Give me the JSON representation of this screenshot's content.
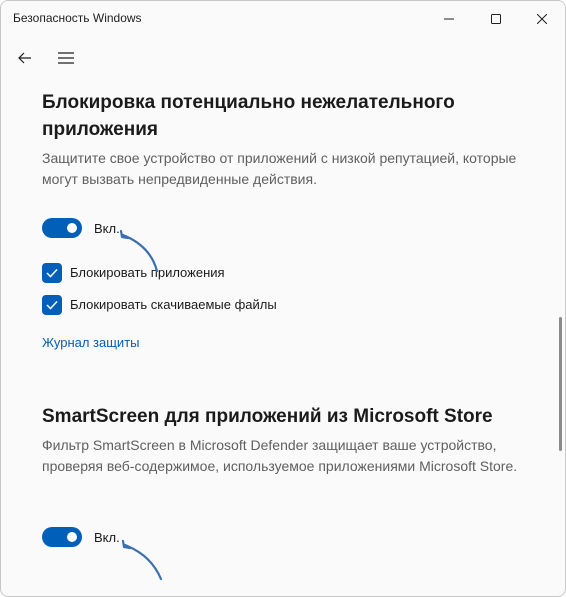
{
  "window": {
    "title": "Безопасность Windows"
  },
  "section1": {
    "heading": "Блокировка потенциально нежелательного приложения",
    "description": "Защитите свое устройство от приложений с низкой репутацией, которые могут вызвать непредвиденные действия.",
    "toggle_label": "Вкл.",
    "toggle_on": true,
    "checkboxes": [
      {
        "label": "Блокировать приложения",
        "checked": true
      },
      {
        "label": "Блокировать скачиваемые файлы",
        "checked": true
      }
    ],
    "link": "Журнал защиты"
  },
  "section2": {
    "heading": "SmartScreen для приложений из Microsoft Store",
    "description": "Фильтр SmartScreen в Microsoft Defender защищает ваше устройство, проверяя веб-содержимое, используемое приложениями Microsoft Store.",
    "toggle_label": "Вкл.",
    "toggle_on": true
  },
  "colors": {
    "accent": "#005fb8",
    "annotation_arrow": "#3a6fb0"
  },
  "icons": {
    "back": "arrow-left-icon",
    "menu": "hamburger-icon",
    "minimize": "minimize-icon",
    "maximize": "maximize-icon",
    "close": "close-icon",
    "check": "check-icon"
  }
}
